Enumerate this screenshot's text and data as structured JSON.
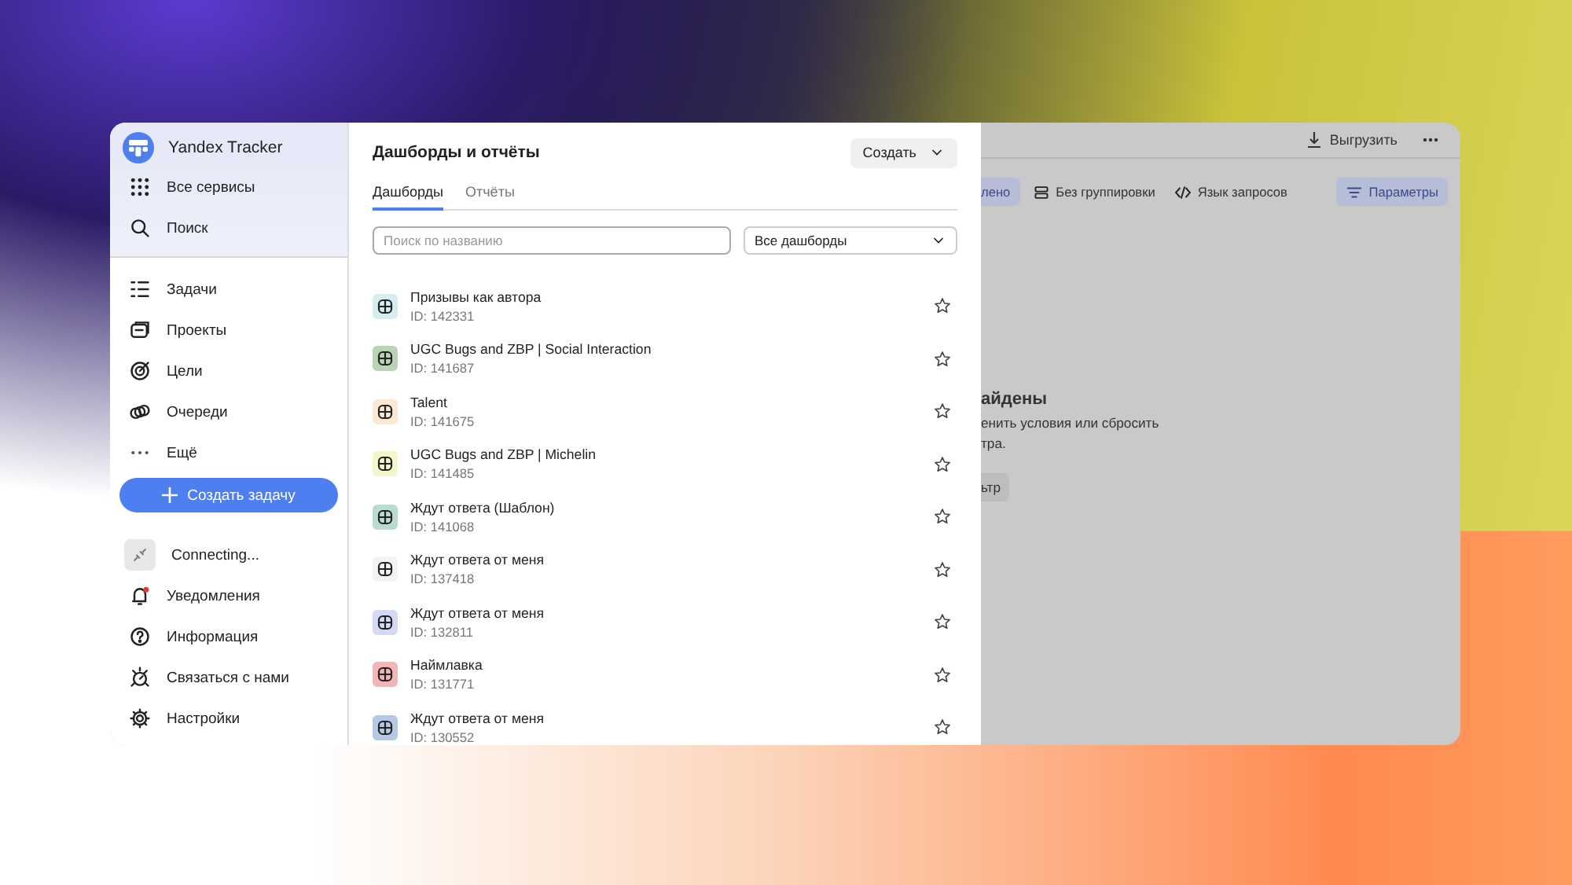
{
  "sidebar": {
    "product": "Yandex Tracker",
    "top_items": [
      "Все сервисы",
      "Поиск"
    ],
    "nav_items": [
      "Задачи",
      "Проекты",
      "Цели",
      "Очереди",
      "Ещё"
    ],
    "create_button": "Создать задачу",
    "bottom_items": [
      "Connecting...",
      "Уведомления",
      "Информация",
      "Связаться с нами",
      "Настройки"
    ]
  },
  "panel": {
    "title": "Дашборды и отчёты",
    "create_button": "Создать",
    "tabs": [
      {
        "label": "Дашборды",
        "selected": true
      },
      {
        "label": "Отчёты",
        "selected": false
      }
    ],
    "search": {
      "placeholder": "Поиск по названию"
    },
    "filter": {
      "value": "Все дашборды"
    },
    "dashboards": [
      {
        "name": "Призывы как автора",
        "id": "ID: 142331",
        "color": "#d4eef0"
      },
      {
        "name": "UGC Bugs and ZBP | Social Interaction",
        "id": "ID: 141687",
        "color": "#b9d3b5"
      },
      {
        "name": "Talent",
        "id": "ID: 141675",
        "color": "#fbe9d6"
      },
      {
        "name": "UGC Bugs and ZBP | Michelin",
        "id": "ID: 141485",
        "color": "#f4f6cc"
      },
      {
        "name": "Ждут ответа (Шаблон)",
        "id": "ID: 141068",
        "color": "#b8ddd0"
      },
      {
        "name": "Ждут ответа от меня",
        "id": "ID: 137418",
        "color": "#f3f3f5"
      },
      {
        "name": "Ждут ответа от меня",
        "id": "ID: 132811",
        "color": "#d6d9f5"
      },
      {
        "name": "Наймлавка",
        "id": "ID: 131771",
        "color": "#f2b5b5"
      },
      {
        "name": "Ждут ответа от меня",
        "id": "ID: 130552",
        "color": "#b6c8e3"
      }
    ]
  },
  "background_page": {
    "export_button": "Выгрузить",
    "toolbar": [
      {
        "label": "лено",
        "selected": true
      },
      {
        "label": "Без группировки",
        "selected": false
      },
      {
        "label": "Язык запросов",
        "selected": false
      },
      {
        "label": "Параметры",
        "selected": true
      }
    ],
    "empty_title": "айдены",
    "empty_text_lines": [
      "енить условия или сбросить",
      "тра."
    ],
    "reset_button": "ьтр"
  }
}
